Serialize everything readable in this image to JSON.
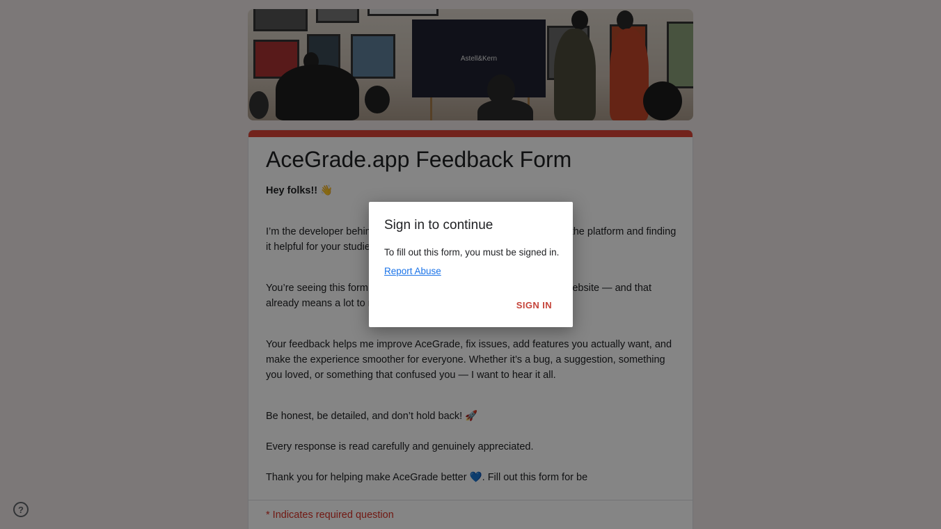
{
  "form": {
    "title": "AceGrade.app Feedback Form",
    "greeting": "Hey folks!! 👋",
    "paragraph_1": "I’m the developer behind AceGrade.app, and I hope you’re enjoying the platform and finding it helpful for your studies.",
    "paragraph_2": "You’re seeing this form because you’ve spent some time using our website — and that already means a lot to me.",
    "paragraph_3": "Your feedback helps me improve AceGrade, fix issues, add features you actually want, and make the experience smoother for everyone. Whether it’s a bug, a suggestion, something you loved, or something that confused you — I want to hear it all.",
    "paragraph_4": "Be honest, be detailed, and don’t hold back! 🚀",
    "paragraph_5": "Every response is read carefully and genuinely appreciated.",
    "paragraph_6": "Thank you for helping make AceGrade better 💙. Fill out this form for be",
    "required_note": "* Indicates required question",
    "accent_color": "#db4437"
  },
  "header_image": {
    "screen_text": "Astell&Kern"
  },
  "dialog": {
    "title": "Sign in to continue",
    "message": "To fill out this form, you must be signed in.",
    "report_link": "Report Abuse",
    "sign_in_button": "SIGN IN"
  },
  "help": {
    "icon": "help-circle-icon",
    "glyph": "?"
  }
}
